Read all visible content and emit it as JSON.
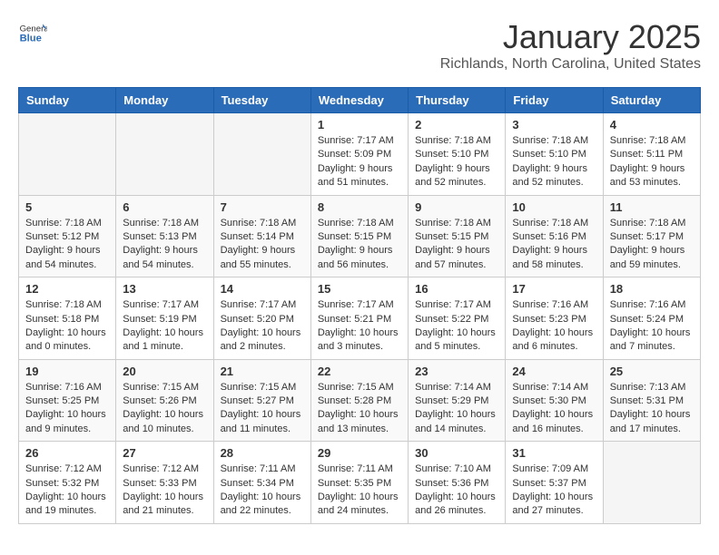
{
  "header": {
    "logo_general": "General",
    "logo_blue": "Blue",
    "month": "January 2025",
    "location": "Richlands, North Carolina, United States"
  },
  "weekdays": [
    "Sunday",
    "Monday",
    "Tuesday",
    "Wednesday",
    "Thursday",
    "Friday",
    "Saturday"
  ],
  "weeks": [
    [
      {
        "day": "",
        "info": ""
      },
      {
        "day": "",
        "info": ""
      },
      {
        "day": "",
        "info": ""
      },
      {
        "day": "1",
        "info": "Sunrise: 7:17 AM\nSunset: 5:09 PM\nDaylight: 9 hours and 51 minutes."
      },
      {
        "day": "2",
        "info": "Sunrise: 7:18 AM\nSunset: 5:10 PM\nDaylight: 9 hours and 52 minutes."
      },
      {
        "day": "3",
        "info": "Sunrise: 7:18 AM\nSunset: 5:10 PM\nDaylight: 9 hours and 52 minutes."
      },
      {
        "day": "4",
        "info": "Sunrise: 7:18 AM\nSunset: 5:11 PM\nDaylight: 9 hours and 53 minutes."
      }
    ],
    [
      {
        "day": "5",
        "info": "Sunrise: 7:18 AM\nSunset: 5:12 PM\nDaylight: 9 hours and 54 minutes."
      },
      {
        "day": "6",
        "info": "Sunrise: 7:18 AM\nSunset: 5:13 PM\nDaylight: 9 hours and 54 minutes."
      },
      {
        "day": "7",
        "info": "Sunrise: 7:18 AM\nSunset: 5:14 PM\nDaylight: 9 hours and 55 minutes."
      },
      {
        "day": "8",
        "info": "Sunrise: 7:18 AM\nSunset: 5:15 PM\nDaylight: 9 hours and 56 minutes."
      },
      {
        "day": "9",
        "info": "Sunrise: 7:18 AM\nSunset: 5:15 PM\nDaylight: 9 hours and 57 minutes."
      },
      {
        "day": "10",
        "info": "Sunrise: 7:18 AM\nSunset: 5:16 PM\nDaylight: 9 hours and 58 minutes."
      },
      {
        "day": "11",
        "info": "Sunrise: 7:18 AM\nSunset: 5:17 PM\nDaylight: 9 hours and 59 minutes."
      }
    ],
    [
      {
        "day": "12",
        "info": "Sunrise: 7:18 AM\nSunset: 5:18 PM\nDaylight: 10 hours and 0 minutes."
      },
      {
        "day": "13",
        "info": "Sunrise: 7:17 AM\nSunset: 5:19 PM\nDaylight: 10 hours and 1 minute."
      },
      {
        "day": "14",
        "info": "Sunrise: 7:17 AM\nSunset: 5:20 PM\nDaylight: 10 hours and 2 minutes."
      },
      {
        "day": "15",
        "info": "Sunrise: 7:17 AM\nSunset: 5:21 PM\nDaylight: 10 hours and 3 minutes."
      },
      {
        "day": "16",
        "info": "Sunrise: 7:17 AM\nSunset: 5:22 PM\nDaylight: 10 hours and 5 minutes."
      },
      {
        "day": "17",
        "info": "Sunrise: 7:16 AM\nSunset: 5:23 PM\nDaylight: 10 hours and 6 minutes."
      },
      {
        "day": "18",
        "info": "Sunrise: 7:16 AM\nSunset: 5:24 PM\nDaylight: 10 hours and 7 minutes."
      }
    ],
    [
      {
        "day": "19",
        "info": "Sunrise: 7:16 AM\nSunset: 5:25 PM\nDaylight: 10 hours and 9 minutes."
      },
      {
        "day": "20",
        "info": "Sunrise: 7:15 AM\nSunset: 5:26 PM\nDaylight: 10 hours and 10 minutes."
      },
      {
        "day": "21",
        "info": "Sunrise: 7:15 AM\nSunset: 5:27 PM\nDaylight: 10 hours and 11 minutes."
      },
      {
        "day": "22",
        "info": "Sunrise: 7:15 AM\nSunset: 5:28 PM\nDaylight: 10 hours and 13 minutes."
      },
      {
        "day": "23",
        "info": "Sunrise: 7:14 AM\nSunset: 5:29 PM\nDaylight: 10 hours and 14 minutes."
      },
      {
        "day": "24",
        "info": "Sunrise: 7:14 AM\nSunset: 5:30 PM\nDaylight: 10 hours and 16 minutes."
      },
      {
        "day": "25",
        "info": "Sunrise: 7:13 AM\nSunset: 5:31 PM\nDaylight: 10 hours and 17 minutes."
      }
    ],
    [
      {
        "day": "26",
        "info": "Sunrise: 7:12 AM\nSunset: 5:32 PM\nDaylight: 10 hours and 19 minutes."
      },
      {
        "day": "27",
        "info": "Sunrise: 7:12 AM\nSunset: 5:33 PM\nDaylight: 10 hours and 21 minutes."
      },
      {
        "day": "28",
        "info": "Sunrise: 7:11 AM\nSunset: 5:34 PM\nDaylight: 10 hours and 22 minutes."
      },
      {
        "day": "29",
        "info": "Sunrise: 7:11 AM\nSunset: 5:35 PM\nDaylight: 10 hours and 24 minutes."
      },
      {
        "day": "30",
        "info": "Sunrise: 7:10 AM\nSunset: 5:36 PM\nDaylight: 10 hours and 26 minutes."
      },
      {
        "day": "31",
        "info": "Sunrise: 7:09 AM\nSunset: 5:37 PM\nDaylight: 10 hours and 27 minutes."
      },
      {
        "day": "",
        "info": ""
      }
    ]
  ]
}
